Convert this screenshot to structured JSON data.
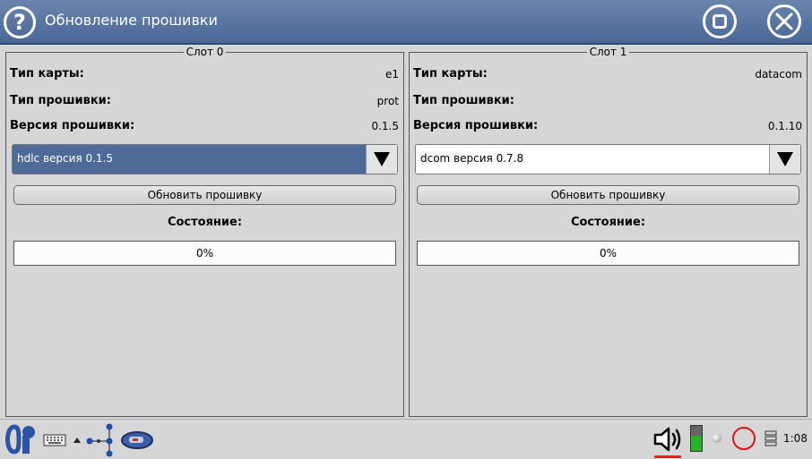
{
  "window": {
    "title": "Обновление прошивки",
    "help_icon": "help-icon",
    "max_icon": "maximize-icon",
    "close_icon": "close-icon"
  },
  "slots": [
    {
      "legend": "Слот 0",
      "card_type_label": "Тип карты:",
      "card_type_value": "e1",
      "fw_type_label": "Тип прошивки:",
      "fw_type_value": "prot",
      "fw_version_label": "Версия прошивки:",
      "fw_version_value": "0.1.5",
      "select_value": "hdlc версия 0.1.5",
      "update_button": "Обновить прошивку",
      "state_label": "Состояние:",
      "progress_text": "0%",
      "progress_value": 0
    },
    {
      "legend": "Слот 1",
      "card_type_label": "Тип карты:",
      "card_type_value": "datacom",
      "fw_type_label": "Тип прошивки:",
      "fw_type_value": "",
      "fw_version_label": "Версия прошивки:",
      "fw_version_value": "0.1.10",
      "select_value": "dcom версия 0.7.8",
      "update_button": "Обновить прошивку",
      "state_label": "Состояние:",
      "progress_text": "0%",
      "progress_value": 0
    }
  ],
  "taskbar": {
    "clock": "1:08",
    "icons": [
      "start-menu-icon",
      "keyboard-icon",
      "network-icon",
      "device-icon",
      "speaker-icon",
      "battery-icon",
      "status-dot-icon",
      "record-icon",
      "menu-icon"
    ]
  },
  "colors": {
    "titlebar": "#4a6797",
    "selected": "#4e6a98",
    "background": "#d6d6d6"
  }
}
